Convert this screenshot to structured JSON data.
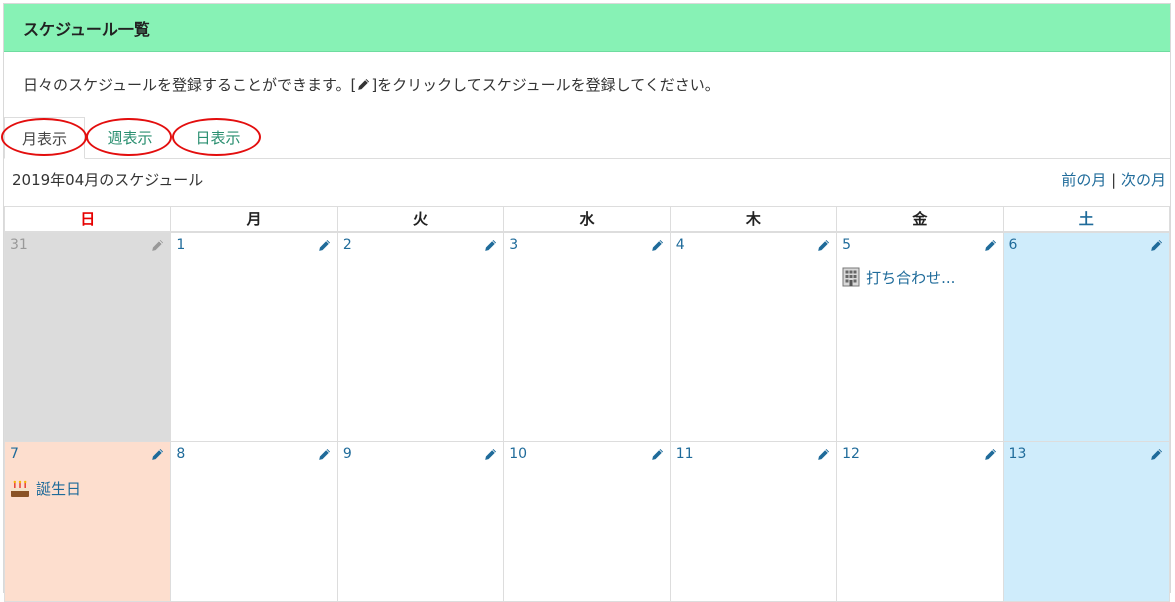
{
  "panel": {
    "title": "スケジュール一覧"
  },
  "intro": {
    "before": "日々のスケジュールを登録することができます。[",
    "after": "]をクリックしてスケジュールを登録してください。"
  },
  "tabs": [
    {
      "label": "月表示",
      "active": true
    },
    {
      "label": "週表示",
      "active": false
    },
    {
      "label": "日表示",
      "active": false
    }
  ],
  "month": {
    "title": "2019年04月のスケジュール",
    "prev_label": "前の月",
    "separator": "|",
    "next_label": "次の月"
  },
  "weekdays": [
    "日",
    "月",
    "火",
    "水",
    "木",
    "金",
    "土"
  ],
  "weeks": [
    {
      "days": [
        {
          "num": "31"
        },
        {
          "num": "1"
        },
        {
          "num": "2"
        },
        {
          "num": "3"
        },
        {
          "num": "4"
        },
        {
          "num": "5",
          "event": "打ち合わせ..."
        },
        {
          "num": "6"
        }
      ]
    },
    {
      "days": [
        {
          "num": "7",
          "event": "誕生日"
        },
        {
          "num": "8"
        },
        {
          "num": "9"
        },
        {
          "num": "10"
        },
        {
          "num": "11"
        },
        {
          "num": "12"
        },
        {
          "num": "13"
        }
      ]
    }
  ],
  "colors": {
    "header_bg": "#87f2b5",
    "link": "#1f6b9a",
    "tab_link": "#2a8f70",
    "sunday": "#e60000",
    "saturday_bg": "#cfecfb",
    "prev_month_bg": "#dcdcdc",
    "birthday_bg": "#fddece",
    "annotation_oval": "#e30e0e"
  },
  "icons": {
    "edit": "pencil-icon",
    "meeting": "building-icon",
    "birthday": "cake-icon"
  }
}
